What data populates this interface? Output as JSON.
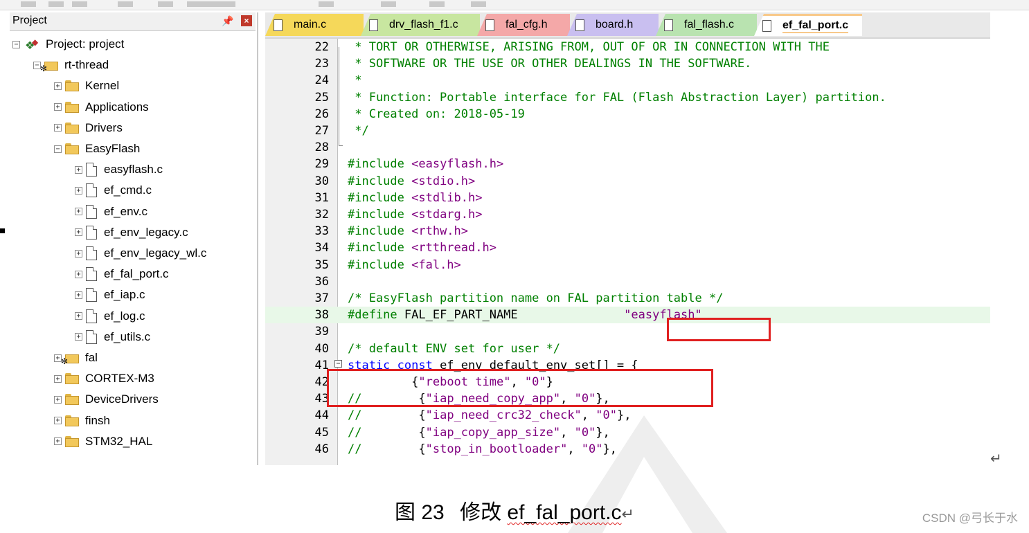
{
  "project_pane": {
    "title": "Project",
    "tree": [
      {
        "label": "Project: project",
        "icon": "project-icon",
        "expander": "⊟"
      },
      {
        "label": "rt-thread",
        "icon": "gear-folder-icon",
        "expander": "⊟"
      },
      {
        "label": "Kernel",
        "icon": "folder-icon",
        "expander": "+"
      },
      {
        "label": "Applications",
        "icon": "folder-icon",
        "expander": "+"
      },
      {
        "label": "Drivers",
        "icon": "folder-icon",
        "expander": "+"
      },
      {
        "label": "EasyFlash",
        "icon": "folder-open-icon",
        "expander": "−"
      },
      {
        "label": "easyflash.c",
        "icon": "file-icon",
        "expander": "+"
      },
      {
        "label": "ef_cmd.c",
        "icon": "file-icon",
        "expander": "+"
      },
      {
        "label": "ef_env.c",
        "icon": "file-icon",
        "expander": "+"
      },
      {
        "label": "ef_env_legacy.c",
        "icon": "file-icon",
        "expander": "+"
      },
      {
        "label": "ef_env_legacy_wl.c",
        "icon": "file-icon",
        "expander": "+"
      },
      {
        "label": "ef_fal_port.c",
        "icon": "file-icon",
        "expander": "+"
      },
      {
        "label": "ef_iap.c",
        "icon": "file-icon",
        "expander": "+"
      },
      {
        "label": "ef_log.c",
        "icon": "file-icon",
        "expander": "+"
      },
      {
        "label": "ef_utils.c",
        "icon": "file-icon",
        "expander": "+"
      },
      {
        "label": "fal",
        "icon": "gear-folder-icon",
        "expander": "+"
      },
      {
        "label": "CORTEX-M3",
        "icon": "folder-icon",
        "expander": "+"
      },
      {
        "label": "DeviceDrivers",
        "icon": "folder-icon",
        "expander": "+"
      },
      {
        "label": "finsh",
        "icon": "folder-icon",
        "expander": "+"
      },
      {
        "label": "STM32_HAL",
        "icon": "folder-icon",
        "expander": "+"
      }
    ]
  },
  "tabs": [
    {
      "label": "main.c",
      "color": "#f5d85a",
      "active": false
    },
    {
      "label": "drv_flash_f1.c",
      "color": "#c8e6a0",
      "active": false
    },
    {
      "label": "fal_cfg.h",
      "color": "#f4a8a8",
      "active": false
    },
    {
      "label": "board.h",
      "color": "#c9bff0",
      "active": false
    },
    {
      "label": "fal_flash.c",
      "color": "#b9e3b0",
      "active": false
    },
    {
      "label": "ef_fal_port.c",
      "color": "#f8c98a",
      "active": true
    }
  ],
  "code_lines": [
    {
      "n": "22",
      "text": " * TORT OR OTHERWISE, ARISING FROM, OUT OF OR IN CONNECTION WITH THE"
    },
    {
      "n": "23",
      "text": " * SOFTWARE OR THE USE OR OTHER DEALINGS IN THE SOFTWARE."
    },
    {
      "n": "24",
      "text": " *"
    },
    {
      "n": "25",
      "text": " * Function: Portable interface for FAL (Flash Abstraction Layer) partition."
    },
    {
      "n": "26",
      "text": " * Created on: 2018-05-19"
    },
    {
      "n": "27",
      "text": " */"
    },
    {
      "n": "28",
      "text": ""
    },
    {
      "n": "29",
      "pp": "#include ",
      "hdr": "<easyflash.h>"
    },
    {
      "n": "30",
      "pp": "#include ",
      "hdr": "<stdio.h>"
    },
    {
      "n": "31",
      "pp": "#include ",
      "hdr": "<stdlib.h>"
    },
    {
      "n": "32",
      "pp": "#include ",
      "hdr": "<stdarg.h>"
    },
    {
      "n": "33",
      "pp": "#include ",
      "hdr": "<rthw.h>"
    },
    {
      "n": "34",
      "pp": "#include ",
      "hdr": "<rtthread.h>"
    },
    {
      "n": "35",
      "pp": "#include ",
      "hdr": "<fal.h>"
    },
    {
      "n": "36",
      "text": ""
    },
    {
      "n": "37",
      "text": "/* EasyFlash partition name on FAL partition table */"
    },
    {
      "n": "38",
      "pp": "#define ",
      "plain": "FAL_EF_PART_NAME               ",
      "str": "\"easyflash\""
    },
    {
      "n": "39",
      "text": ""
    },
    {
      "n": "40",
      "text": "/* default ENV set for user */"
    },
    {
      "n": "41",
      "kw": "static const ",
      "plain": "ef_env default_env_set[] = {"
    },
    {
      "n": "42",
      "indent": "         ",
      "plain_a": "{",
      "str": "\"reboot time\"",
      "plain_b": ", ",
      "str2": "\"0\"",
      "plain_c": "}"
    },
    {
      "n": "43",
      "cm": "//",
      "indent": "        ",
      "plain_a": "{",
      "str": "\"iap_need_copy_app\"",
      "plain_b": ", ",
      "str2": "\"0\"",
      "plain_c": "},"
    },
    {
      "n": "44",
      "cm": "//",
      "indent": "        ",
      "plain_a": "{",
      "str": "\"iap_need_crc32_check\"",
      "plain_b": ", ",
      "str2": "\"0\"",
      "plain_c": "},"
    },
    {
      "n": "45",
      "cm": "//",
      "indent": "        ",
      "plain_a": "{",
      "str": "\"iap_copy_app_size\"",
      "plain_b": ", ",
      "str2": "\"0\"",
      "plain_c": "},"
    },
    {
      "n": "46",
      "cm": "//",
      "indent": "        ",
      "plain_a": "{",
      "str": "\"stop_in_bootloader\"",
      "plain_b": ", ",
      "str2": "\"0\"",
      "plain_c": "},"
    }
  ],
  "caption": {
    "prefix": "图 23",
    "text": "修改",
    "filename": "ef_fal_port.c"
  },
  "watermark": "CSDN @弓长于水",
  "colors": {
    "highlight_box": "#e02020",
    "comment": "#008000",
    "keyword": "#0000ff",
    "string": "#800080"
  }
}
